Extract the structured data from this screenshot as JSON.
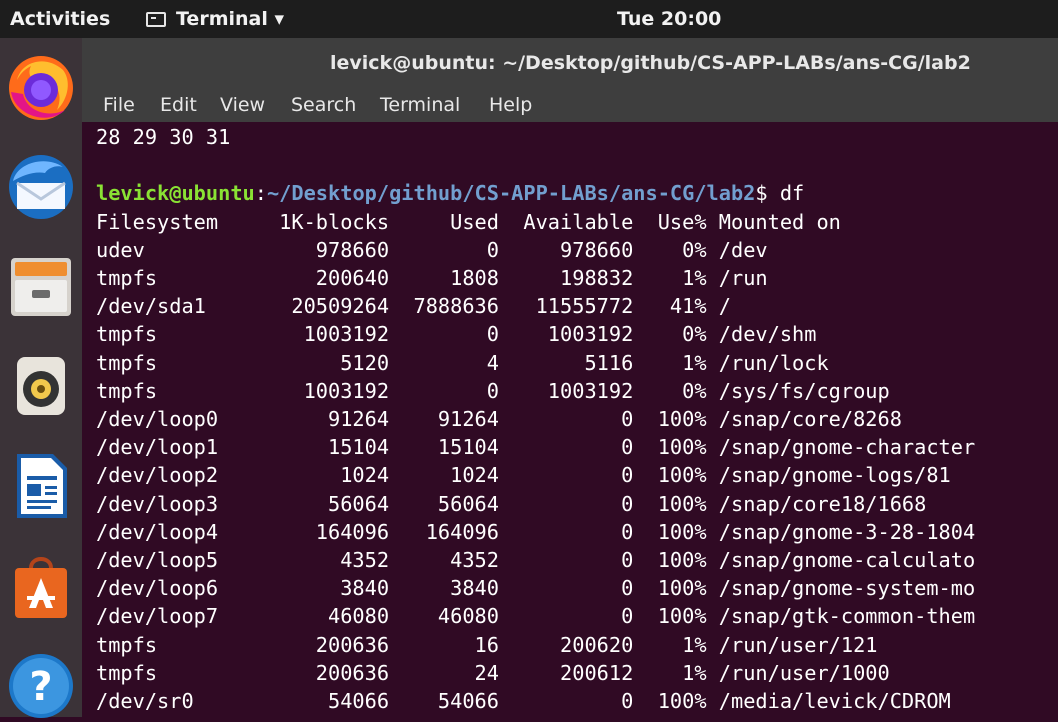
{
  "topbar": {
    "activities": "Activities",
    "app_menu": "Terminal ▾",
    "clock": "Tue 20:00"
  },
  "dock": {
    "items": [
      "firefox",
      "thunderbird",
      "files",
      "rhythmbox",
      "libreoffice-writer",
      "ubuntu-software",
      "help"
    ]
  },
  "window": {
    "title": "levick@ubuntu: ~/Desktop/github/CS-APP-LABs/ans-CG/lab2",
    "menu": [
      "File",
      "Edit",
      "View",
      "Search",
      "Terminal",
      "Help"
    ]
  },
  "terminal": {
    "previous_output": "28 29 30 31",
    "prompt_user": "levick@ubuntu",
    "prompt_sep": ":",
    "prompt_path": "~/Desktop/github/CS-APP-LABs/ans-CG/lab2",
    "prompt_symbol": "$ ",
    "command": "df",
    "df_header": [
      "Filesystem",
      "1K-blocks",
      "Used",
      "Available",
      "Use%",
      "Mounted on"
    ],
    "df_rows": [
      [
        "udev",
        "978660",
        "0",
        "978660",
        "0%",
        "/dev"
      ],
      [
        "tmpfs",
        "200640",
        "1808",
        "198832",
        "1%",
        "/run"
      ],
      [
        "/dev/sda1",
        "20509264",
        "7888636",
        "11555772",
        "41%",
        "/"
      ],
      [
        "tmpfs",
        "1003192",
        "0",
        "1003192",
        "0%",
        "/dev/shm"
      ],
      [
        "tmpfs",
        "5120",
        "4",
        "5116",
        "1%",
        "/run/lock"
      ],
      [
        "tmpfs",
        "1003192",
        "0",
        "1003192",
        "0%",
        "/sys/fs/cgroup"
      ],
      [
        "/dev/loop0",
        "91264",
        "91264",
        "0",
        "100%",
        "/snap/core/8268"
      ],
      [
        "/dev/loop1",
        "15104",
        "15104",
        "0",
        "100%",
        "/snap/gnome-character"
      ],
      [
        "/dev/loop2",
        "1024",
        "1024",
        "0",
        "100%",
        "/snap/gnome-logs/81"
      ],
      [
        "/dev/loop3",
        "56064",
        "56064",
        "0",
        "100%",
        "/snap/core18/1668"
      ],
      [
        "/dev/loop4",
        "164096",
        "164096",
        "0",
        "100%",
        "/snap/gnome-3-28-1804"
      ],
      [
        "/dev/loop5",
        "4352",
        "4352",
        "0",
        "100%",
        "/snap/gnome-calculato"
      ],
      [
        "/dev/loop6",
        "3840",
        "3840",
        "0",
        "100%",
        "/snap/gnome-system-mo"
      ],
      [
        "/dev/loop7",
        "46080",
        "46080",
        "0",
        "100%",
        "/snap/gtk-common-them"
      ],
      [
        "tmpfs",
        "200636",
        "16",
        "200620",
        "1%",
        "/run/user/121"
      ],
      [
        "tmpfs",
        "200636",
        "24",
        "200612",
        "1%",
        "/run/user/1000"
      ],
      [
        "/dev/sr0",
        "54066",
        "54066",
        "0",
        "100%",
        "/media/levick/CDROM"
      ]
    ]
  }
}
